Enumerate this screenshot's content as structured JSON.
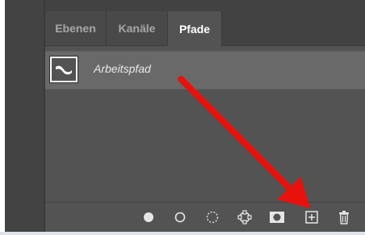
{
  "panel": {
    "tabs": [
      {
        "label": "Ebenen"
      },
      {
        "label": "Kanäle"
      },
      {
        "label": "Pfade"
      }
    ],
    "active_tab": "Pfade"
  },
  "paths": {
    "items": [
      {
        "name": "Arbeitspfad",
        "thumbnail_icon": "wave-path-thumbnail"
      }
    ]
  },
  "footer": {
    "buttons": [
      {
        "icon": "fill-path-icon"
      },
      {
        "icon": "stroke-path-icon"
      },
      {
        "icon": "load-as-selection-icon"
      },
      {
        "icon": "make-work-path-icon"
      },
      {
        "icon": "add-mask-icon"
      },
      {
        "icon": "new-path-icon"
      },
      {
        "icon": "delete-path-icon"
      }
    ]
  },
  "colors": {
    "panel_bg": "#535353",
    "tabbar_bg": "#424242",
    "selected_row": "#696969",
    "annotation_arrow": "#e8120c"
  }
}
